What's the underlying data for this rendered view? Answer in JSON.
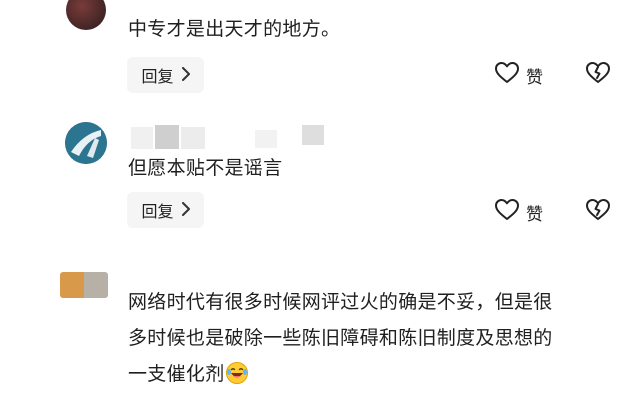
{
  "comments": [
    {
      "text": "中专才是出天才的地方。",
      "reply_label": "回复",
      "like_label": "赞"
    },
    {
      "text": "但愿本贴不是谣言",
      "reply_label": "回复",
      "like_label": "赞"
    },
    {
      "lines": [
        "网络时代有很多时候网评过火的确是不妥，但是很",
        "多时候也是破除一些陈旧障碍和陈旧制度及思想的",
        "一支催化剂"
      ],
      "emoji_icon": "laughing-crying-face-icon"
    }
  ],
  "colors": {
    "reply_bg": "#f5f5f5",
    "text": "#1f1f1f",
    "icon_stroke": "#222222"
  }
}
